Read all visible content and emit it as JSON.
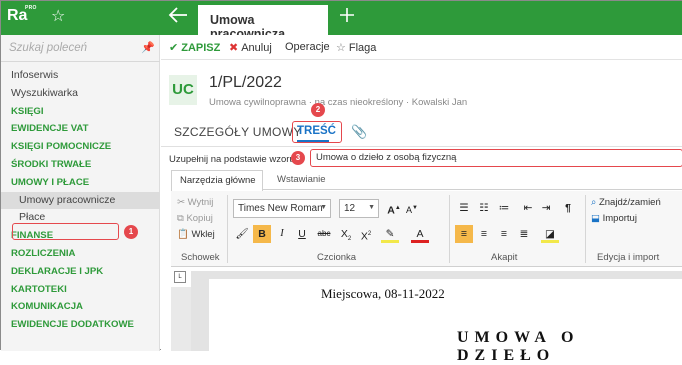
{
  "app": {
    "logo": "Ra",
    "logo_badge": "PRO",
    "active_tab": "Umowa pracownicza"
  },
  "sidebar": {
    "search_placeholder": "Szukaj poleceń",
    "items": [
      {
        "label": "Infoserwis",
        "kind": "plain"
      },
      {
        "label": "Wyszukiwarka",
        "kind": "plain"
      },
      {
        "label": "KSIĘGI",
        "kind": "section"
      },
      {
        "label": "EWIDENCJE VAT",
        "kind": "section"
      },
      {
        "label": "KSIĘGI POMOCNICZE",
        "kind": "section"
      },
      {
        "label": "ŚRODKI TRWAŁE",
        "kind": "section"
      },
      {
        "label": "UMOWY I PŁACE",
        "kind": "section"
      },
      {
        "label": "Umowy pracownicze",
        "kind": "sub",
        "selected": true
      },
      {
        "label": "Płace",
        "kind": "sub"
      },
      {
        "label": "FINANSE",
        "kind": "section"
      },
      {
        "label": "ROZLICZENIA",
        "kind": "section"
      },
      {
        "label": "DEKLARACJE I JPK",
        "kind": "section"
      },
      {
        "label": "KARTOTEKI",
        "kind": "section"
      },
      {
        "label": "KOMUNIKACJA",
        "kind": "section"
      },
      {
        "label": "EWIDENCJE DODATKOWE",
        "kind": "section"
      }
    ]
  },
  "toolbar": {
    "save": "ZAPISZ",
    "cancel": "Anuluj",
    "operations": "Operacje",
    "flag": "Flaga"
  },
  "document": {
    "badge": "UC",
    "number": "1/PL/2022",
    "subtitle": "Umowa cywilnoprawna · na czas nieokreślony · Kowalski Jan"
  },
  "tabs": {
    "details": "SZCZEGÓŁY UMOWY",
    "content": "TREŚĆ"
  },
  "template": {
    "label": "Uzupełnij na podstawie wzoru:",
    "value": "Umowa o dzieło z osobą fizyczną"
  },
  "ribbon": {
    "tabs": [
      "Narzędzia główne",
      "Wstawianie"
    ],
    "clipboard": {
      "cut": "Wytnij",
      "copy": "Kopiuj",
      "paste": "Wklej",
      "group": "Schowek"
    },
    "font": {
      "family": "Times New Roman",
      "size": "12",
      "group": "Czcionka"
    },
    "paragraph": {
      "group": "Akapit"
    },
    "editing": {
      "find": "Znajdź/zamień",
      "import": "Importuj",
      "group": "Edycja i import"
    }
  },
  "page": {
    "place_date": "Miejscowa, 08-11-2022",
    "heading": "UMOWA O DZIEŁO"
  },
  "annotations": [
    "1",
    "2",
    "3"
  ],
  "colors": {
    "brand_green": "#2e9a3a",
    "highlight_red": "#e5484d",
    "link_blue": "#1a73c6"
  }
}
